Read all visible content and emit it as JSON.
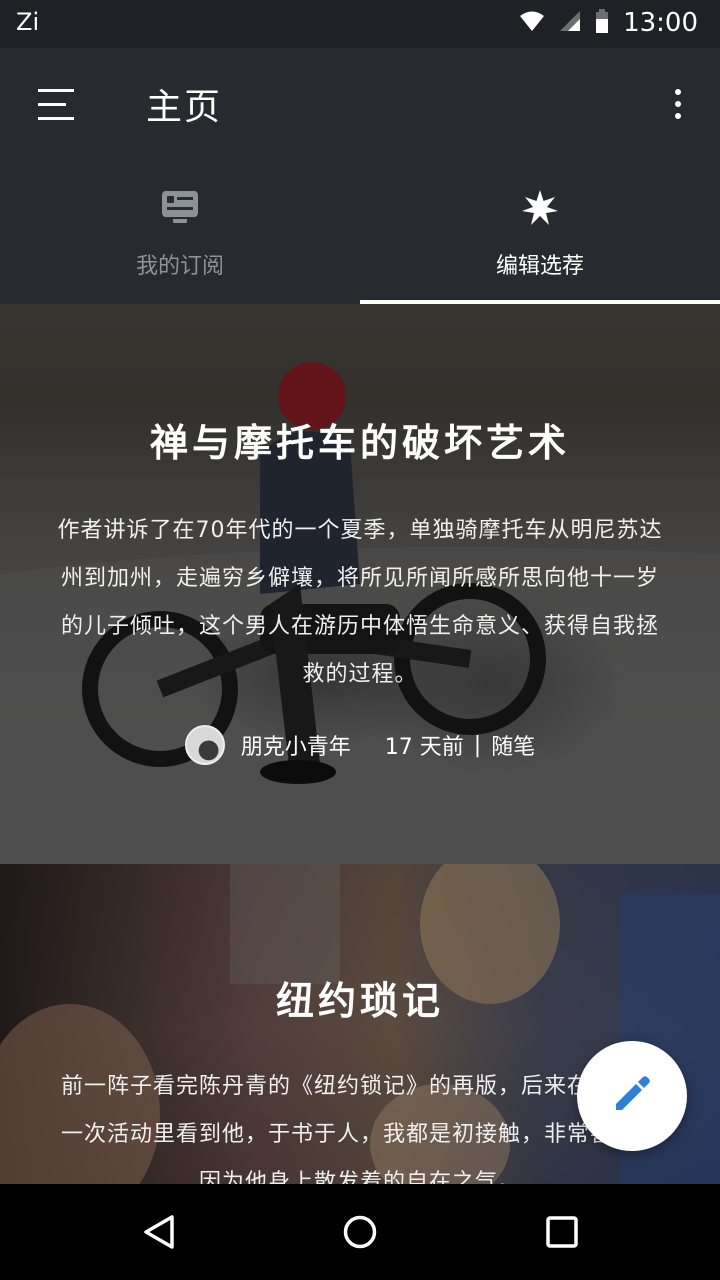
{
  "status_bar": {
    "app_label": "Zi",
    "time": "13:00"
  },
  "toolbar": {
    "title": "主页"
  },
  "tabs": [
    {
      "label": "我的订阅",
      "icon": "subscription-icon",
      "active": false
    },
    {
      "label": "编辑选荐",
      "icon": "star-burst-icon",
      "active": true
    }
  ],
  "cards": [
    {
      "title": "禅与摩托车的破坏艺术",
      "description": "作者讲诉了在70年代的一个夏季，单独骑摩托车从明尼苏达州到加州，走遍穷乡僻壤，将所见所闻所感所思向他十一岁的儿子倾吐，这个男人在游历中体悟生命意义、获得自我拯救的过程。",
      "author": "朋克小青年",
      "time_ago": "17 天前",
      "separator": "|",
      "category": "随笔"
    },
    {
      "title": "纽约琐记",
      "description": "前一阵子看完陈丹青的《纽约锁记》的再版，后来在北大的一次活动里看到他，于书于人，我都是初接触，非常喜欢，因为他身上散发着的自在之气。"
    }
  ],
  "fab": {
    "icon": "pencil-icon"
  },
  "nav": {
    "back": "back-icon",
    "home": "home-icon",
    "recent": "recent-apps-icon"
  }
}
